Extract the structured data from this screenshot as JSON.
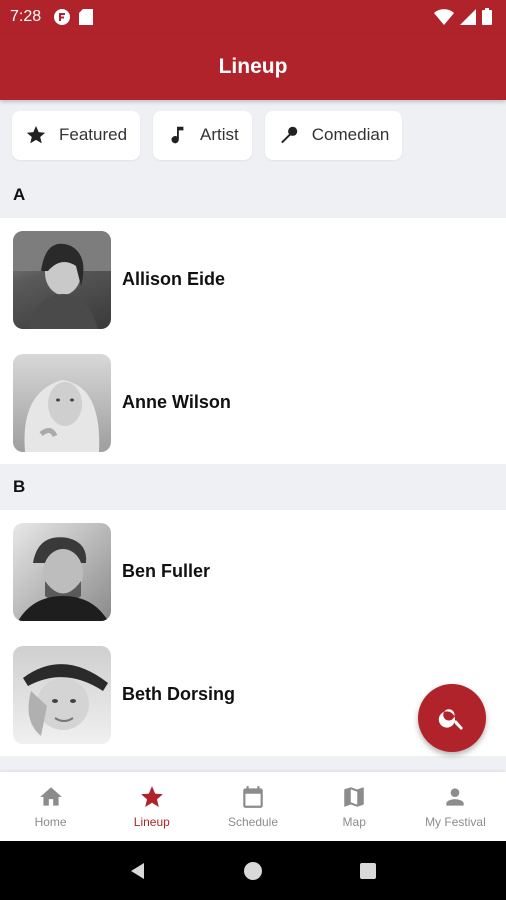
{
  "status_bar": {
    "time": "7:28"
  },
  "app_bar": {
    "title": "Lineup"
  },
  "filters": [
    {
      "label": "Featured",
      "icon": "star-icon"
    },
    {
      "label": "Artist",
      "icon": "music-note-icon"
    },
    {
      "label": "Comedian",
      "icon": "microphone-icon"
    }
  ],
  "sections": [
    {
      "letter": "A",
      "items": [
        {
          "name": "Allison Eide"
        },
        {
          "name": "Anne Wilson"
        }
      ]
    },
    {
      "letter": "B",
      "items": [
        {
          "name": "Ben Fuller"
        },
        {
          "name": "Beth Dorsing"
        }
      ]
    }
  ],
  "fab": {
    "icon": "search-icon"
  },
  "bottom_nav": [
    {
      "label": "Home",
      "icon": "home-icon",
      "active": false
    },
    {
      "label": "Lineup",
      "icon": "star-icon",
      "active": true
    },
    {
      "label": "Schedule",
      "icon": "calendar-icon",
      "active": false
    },
    {
      "label": "Map",
      "icon": "map-icon",
      "active": false
    },
    {
      "label": "My Festival",
      "icon": "person-icon",
      "active": false
    }
  ],
  "colors": {
    "brand": "#b0232a",
    "background": "#eef0f3",
    "inactive": "#8c8c8c"
  }
}
